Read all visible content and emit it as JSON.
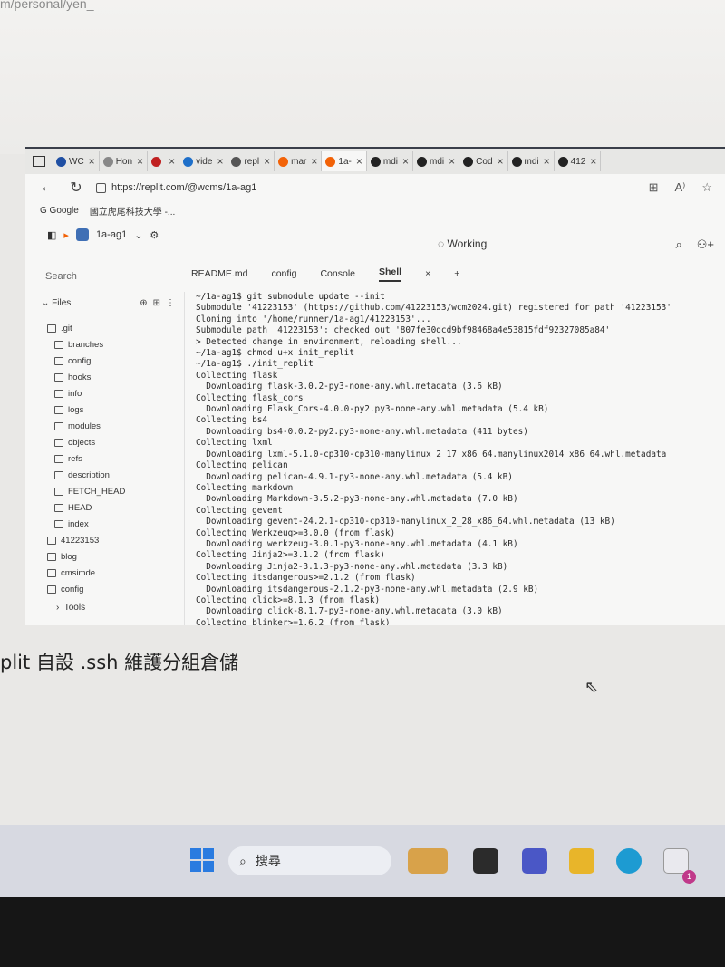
{
  "page_fragment": "m/personal/yen_",
  "browser": {
    "tabs": [
      {
        "label": "WC",
        "color": "#1f4fa3"
      },
      {
        "label": "Hon",
        "color": "#888888"
      },
      {
        "label": "",
        "color": "#c02020"
      },
      {
        "label": "vide",
        "color": "#1e6fc9"
      },
      {
        "label": "repl",
        "color": "#555555"
      },
      {
        "label": "mar",
        "color": "#f26207"
      },
      {
        "label": "1a-",
        "color": "#f26207"
      },
      {
        "label": "mdi",
        "color": "#222222"
      },
      {
        "label": "mdi",
        "color": "#222222"
      },
      {
        "label": "Cod",
        "color": "#222222"
      },
      {
        "label": "mdi",
        "color": "#222222"
      },
      {
        "label": "412",
        "color": "#222222"
      }
    ],
    "url": "https://replit.com/@wcms/1a-ag1",
    "bookmarks": [
      "G Google",
      "國立虎尾科技大學 -..."
    ]
  },
  "replit": {
    "repl_name": "1a-ag1",
    "status": "Working",
    "search_label": "Search",
    "files_label": "Files",
    "tree": [
      {
        "label": ".git",
        "level": 0
      },
      {
        "label": "branches",
        "level": 1
      },
      {
        "label": "config",
        "level": 1
      },
      {
        "label": "hooks",
        "level": 1
      },
      {
        "label": "info",
        "level": 1
      },
      {
        "label": "logs",
        "level": 1
      },
      {
        "label": "modules",
        "level": 1
      },
      {
        "label": "objects",
        "level": 1
      },
      {
        "label": "refs",
        "level": 1
      },
      {
        "label": "description",
        "level": 1
      },
      {
        "label": "FETCH_HEAD",
        "level": 1
      },
      {
        "label": "HEAD",
        "level": 1
      },
      {
        "label": "index",
        "level": 1
      },
      {
        "label": "41223153",
        "level": 0
      },
      {
        "label": "blog",
        "level": 0
      },
      {
        "label": "cmsimde",
        "level": 0
      },
      {
        "label": "config",
        "level": 0
      }
    ],
    "tools_label": "Tools",
    "editor_tabs": [
      "README.md",
      "config",
      "Console",
      "Shell"
    ],
    "terminal_lines": [
      "~/1a-ag1$ git submodule update --init",
      "Submodule '41223153' (https://github.com/41223153/wcm2024.git) registered for path '41223153'",
      "Cloning into '/home/runner/1a-ag1/41223153'...",
      "Submodule path '41223153': checked out '807fe30dcd9bf98468a4e53815fdf92327085a84'",
      "> Detected change in environment, reloading shell...",
      "~/1a-ag1$ chmod u+x init_replit",
      "~/1a-ag1$ ./init_replit",
      "Collecting flask",
      "  Downloading flask-3.0.2-py3-none-any.whl.metadata (3.6 kB)",
      "Collecting flask_cors",
      "  Downloading Flask_Cors-4.0.0-py2.py3-none-any.whl.metadata (5.4 kB)",
      "Collecting bs4",
      "  Downloading bs4-0.0.2-py2.py3-none-any.whl.metadata (411 bytes)",
      "Collecting lxml",
      "  Downloading lxml-5.1.0-cp310-cp310-manylinux_2_17_x86_64.manylinux2014_x86_64.whl.metadata",
      "Collecting pelican",
      "  Downloading pelican-4.9.1-py3-none-any.whl.metadata (5.4 kB)",
      "Collecting markdown",
      "  Downloading Markdown-3.5.2-py3-none-any.whl.metadata (7.0 kB)",
      "Collecting gevent",
      "  Downloading gevent-24.2.1-cp310-cp310-manylinux_2_28_x86_64.whl.metadata (13 kB)",
      "Collecting Werkzeug>=3.0.0 (from flask)",
      "  Downloading werkzeug-3.0.1-py3-none-any.whl.metadata (4.1 kB)",
      "Collecting Jinja2>=3.1.2 (from flask)",
      "  Downloading Jinja2-3.1.3-py3-none-any.whl.metadata (3.3 kB)",
      "Collecting itsdangerous>=2.1.2 (from flask)",
      "  Downloading itsdangerous-2.1.2-py3-none-any.whl.metadata (2.9 kB)",
      "Collecting click>=8.1.3 (from flask)",
      "  Downloading click-8.1.7-py3-none-any.whl.metadata (3.0 kB)",
      "Collecting blinker>=1.6.2 (from flask)"
    ]
  },
  "document": {
    "heading": "plit 自設 .ssh 維護分組倉儲"
  },
  "taskbar": {
    "search_label": "搜尋",
    "notification_count": "1"
  }
}
